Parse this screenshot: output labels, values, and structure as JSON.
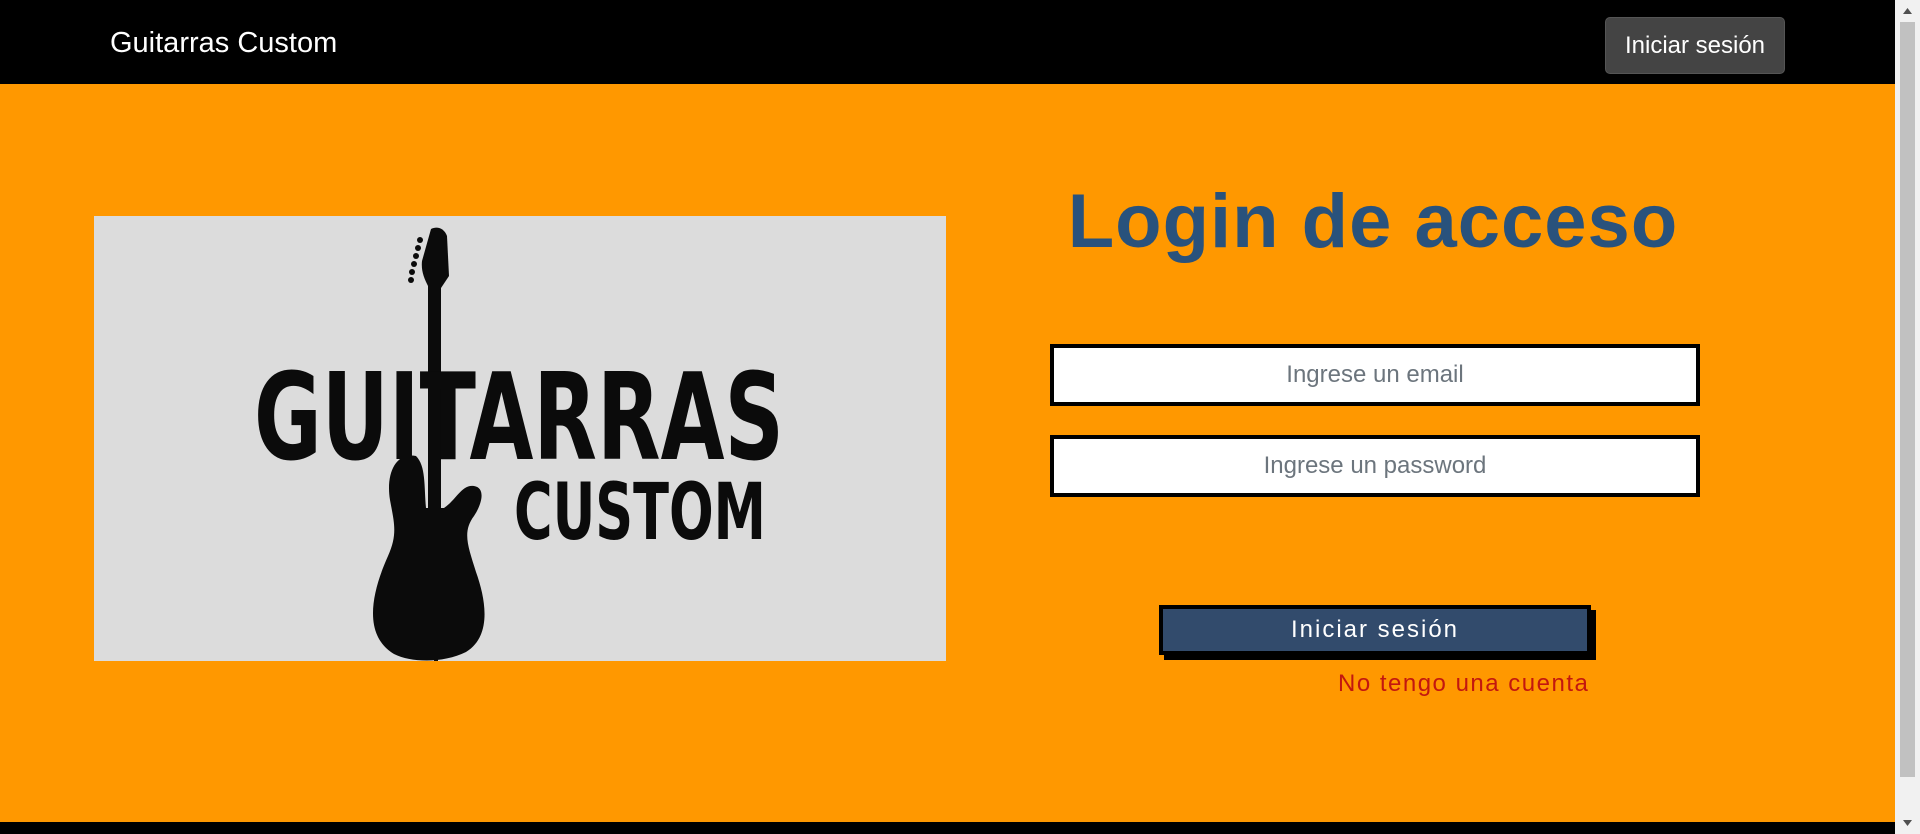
{
  "navbar": {
    "brand": "Guitarras Custom",
    "login_button": "Iniciar sesión"
  },
  "logo": {
    "line1": "GUITARRAS",
    "line2": "CUSTOM"
  },
  "login": {
    "title": "Login de acceso",
    "email_placeholder": "Ingrese un email",
    "password_placeholder": "Ingrese un password",
    "submit_label": "Iniciar sesión",
    "signup_link": "No tengo una cuenta"
  },
  "colors": {
    "background": "#ff9800",
    "title": "#29527c",
    "submit": "#324b6c",
    "link": "#c3170f"
  }
}
